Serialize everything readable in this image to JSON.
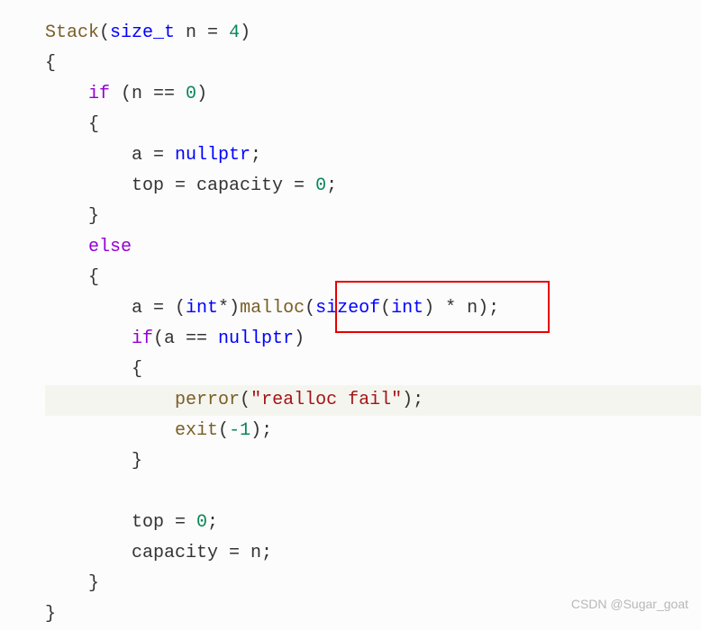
{
  "code": {
    "l1": {
      "t1": "Stack",
      "t2": "(",
      "t3": "size_t",
      "t4": " n = ",
      "t5": "4",
      "t6": ")"
    },
    "l2": "{",
    "l3": {
      "t1": "    ",
      "t2": "if",
      "t3": " (n == ",
      "t4": "0",
      "t5": ")"
    },
    "l4": "    {",
    "l5": {
      "t1": "        a = ",
      "t2": "nullptr",
      "t3": ";"
    },
    "l6": {
      "t1": "        top = capacity = ",
      "t2": "0",
      "t3": ";"
    },
    "l7": "    }",
    "l8": {
      "t1": "    ",
      "t2": "else"
    },
    "l9": "    {",
    "l10": {
      "t1": "        a = (",
      "t2": "int",
      "t3": "*)",
      "t4": "malloc",
      "t5": "(",
      "t6": "sizeof",
      "t7": "(",
      "t8": "int",
      "t9": ") * n);"
    },
    "l11": {
      "t1": "        ",
      "t2": "if",
      "t3": "(a == ",
      "t4": "nullptr",
      "t5": ")"
    },
    "l12": "        {",
    "l13": {
      "t1": "            ",
      "t2": "perror",
      "t3": "(",
      "t4": "\"realloc fail\"",
      "t5": ");"
    },
    "l14": {
      "t1": "            ",
      "t2": "exit",
      "t3": "(",
      "t4": "-1",
      "t5": ");"
    },
    "l15": "        }",
    "l16": " ",
    "l17": {
      "t1": "        top = ",
      "t2": "0",
      "t3": ";"
    },
    "l18": "        capacity = n;",
    "l19": "    }",
    "l20": "}"
  },
  "watermark": "CSDN @Sugar_goat"
}
